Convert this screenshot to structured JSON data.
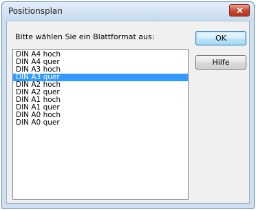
{
  "window": {
    "title": "Positionsplan",
    "close_icon": "close-icon"
  },
  "dialog": {
    "prompt": "Bitte wählen Sie ein Blattformat aus:",
    "formats": [
      "DIN A4 hoch",
      "DIN A4 quer",
      "DIN A3 hoch",
      "DIN A3 quer",
      "DIN A2 hoch",
      "DIN A2 quer",
      "DIN A1 hoch",
      "DIN A1 quer",
      "DIN A0 hoch",
      "DIN A0 quer"
    ],
    "selected": "DIN A3 quer"
  },
  "buttons": {
    "ok_label": "OK",
    "help_label": "Hilfe"
  },
  "colors": {
    "selection": "#3399ff",
    "close_button": "#c7462f"
  }
}
